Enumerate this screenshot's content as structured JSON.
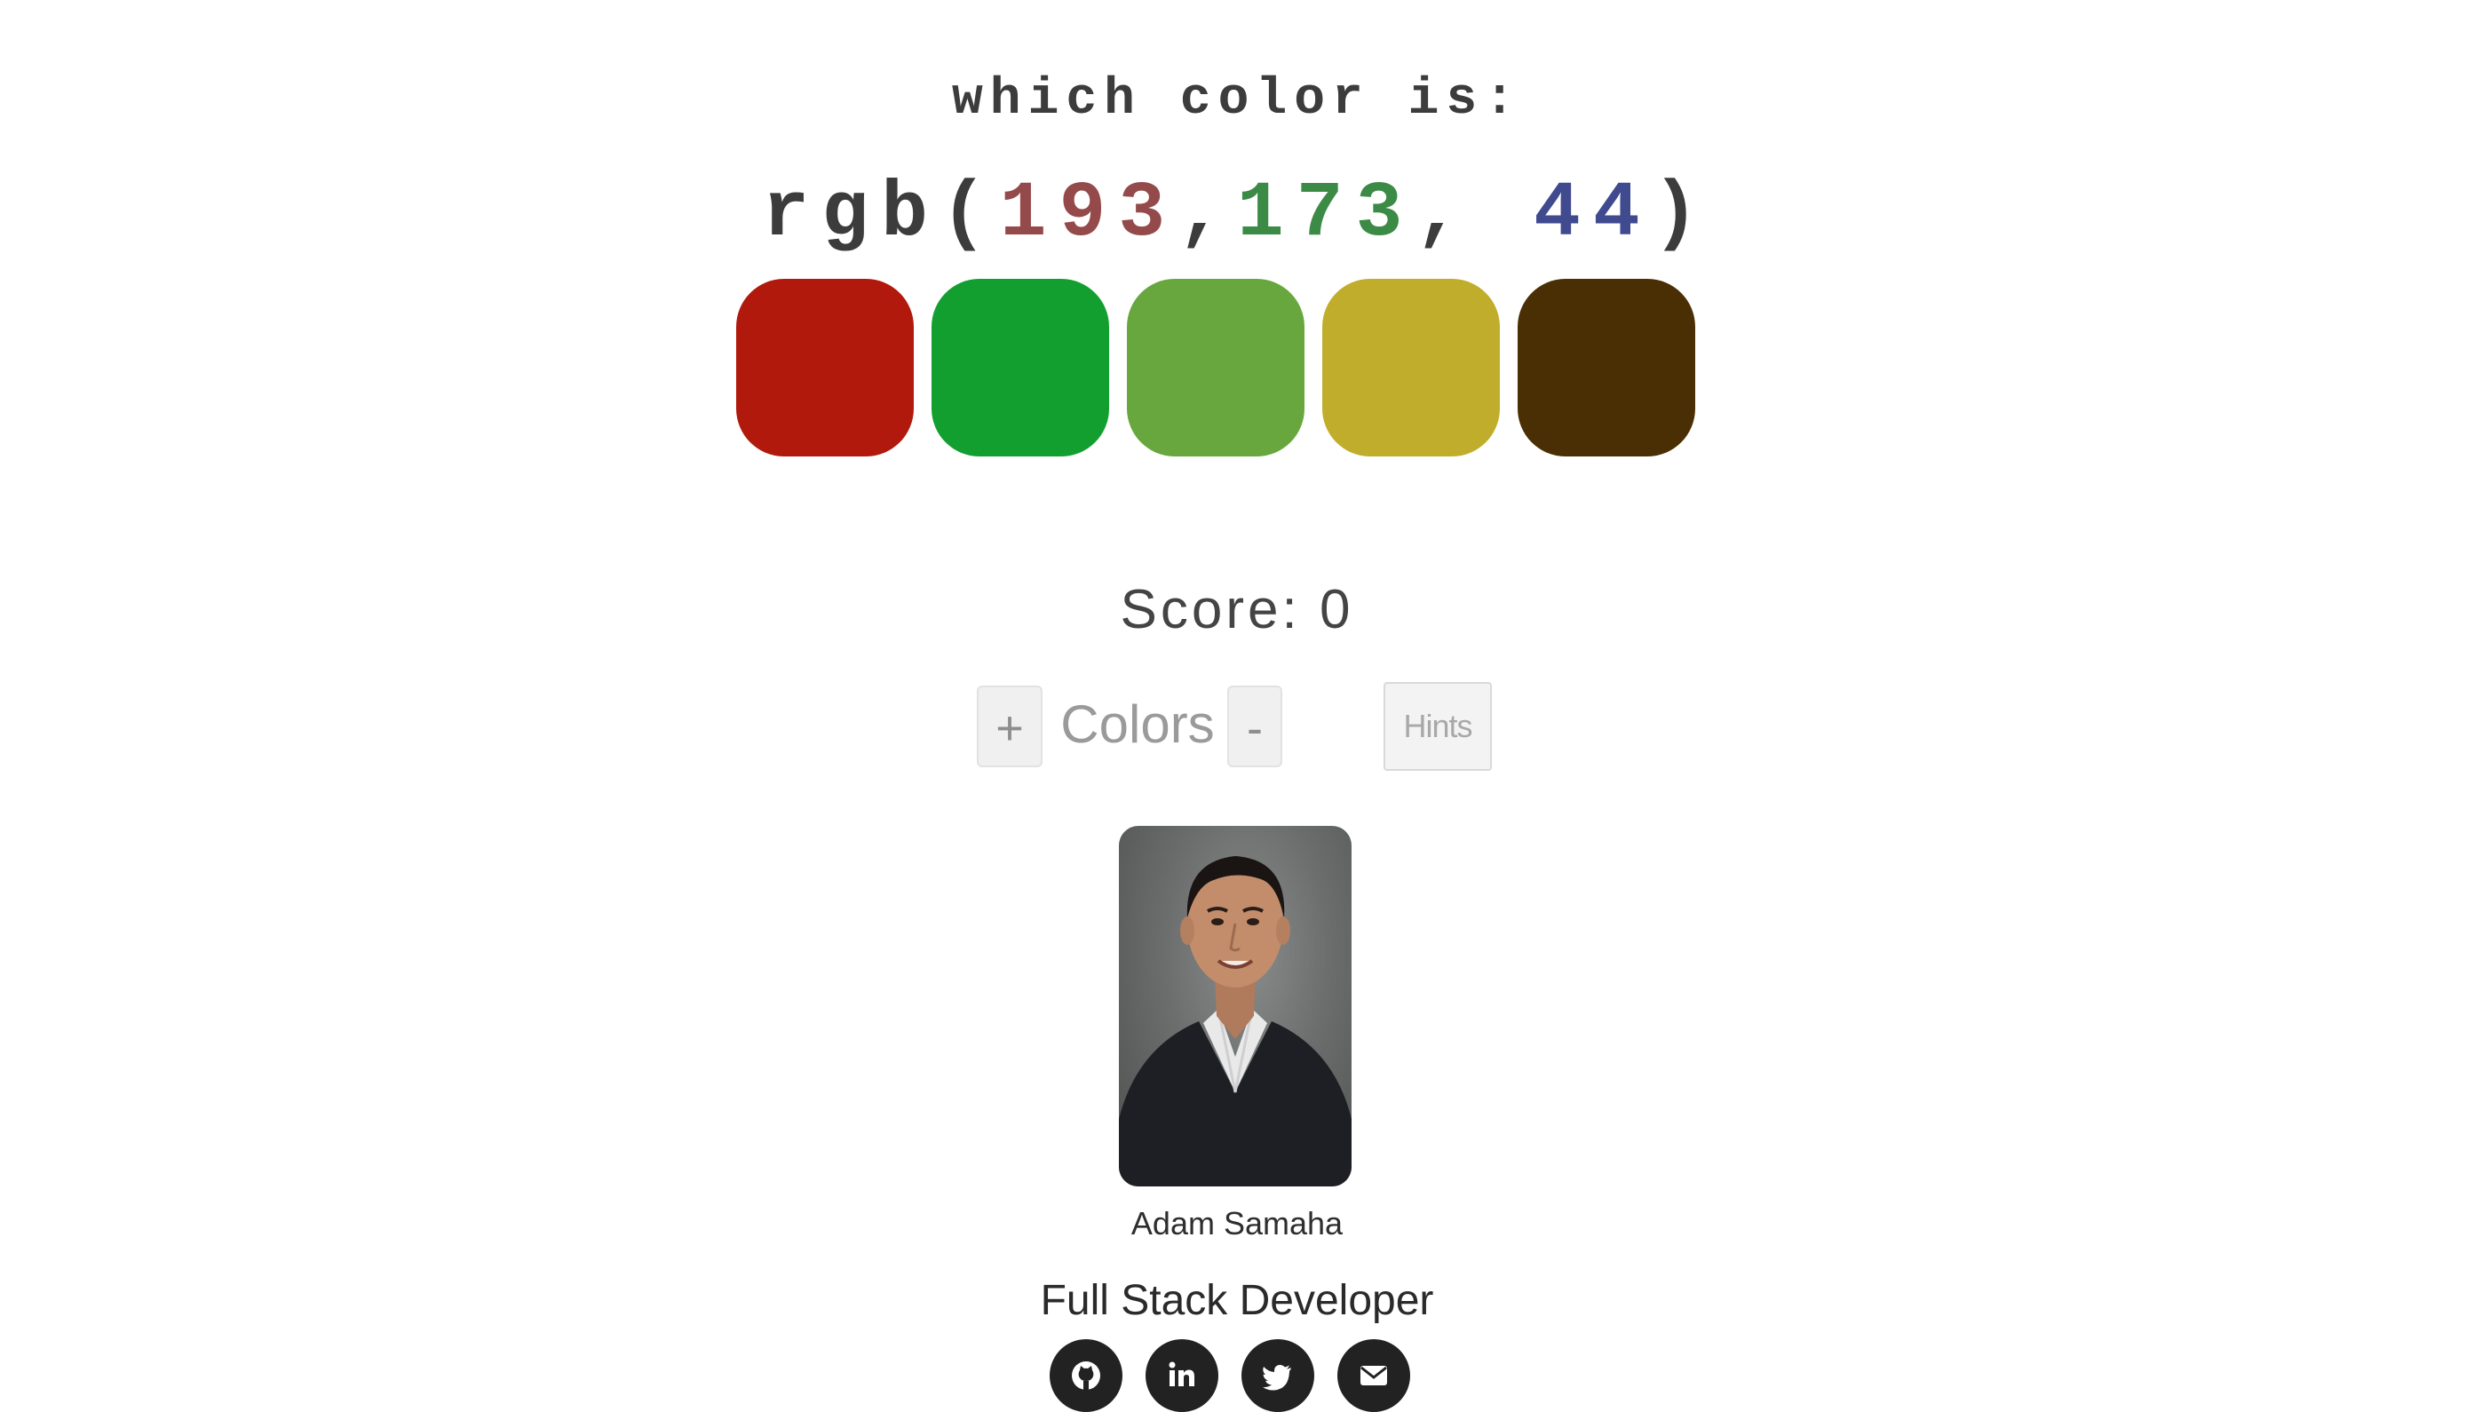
{
  "prompt": {
    "heading": "which color is:",
    "rgb_prefix": "rgb(",
    "red": "193",
    "sep1": ",",
    "green": "173",
    "sep2": ",",
    "blue": " 44",
    "rgb_suffix": ")"
  },
  "swatches": [
    {
      "color": "#b1190c"
    },
    {
      "color": "#139f30"
    },
    {
      "color": "#67a73e"
    },
    {
      "color": "#c1ad2c"
    },
    {
      "color": "#4a2e04"
    }
  ],
  "score": {
    "text": "Score: 0"
  },
  "controls": {
    "plus_label": "+",
    "colors_label": "Colors",
    "minus_label": "-",
    "hints_label": "Hints"
  },
  "profile": {
    "name": "Adam Samaha",
    "role": "Full Stack Developer"
  },
  "social": [
    {
      "icon": "github-icon"
    },
    {
      "icon": "linkedin-icon"
    },
    {
      "icon": "twitter-icon"
    },
    {
      "icon": "envelope-icon"
    }
  ]
}
